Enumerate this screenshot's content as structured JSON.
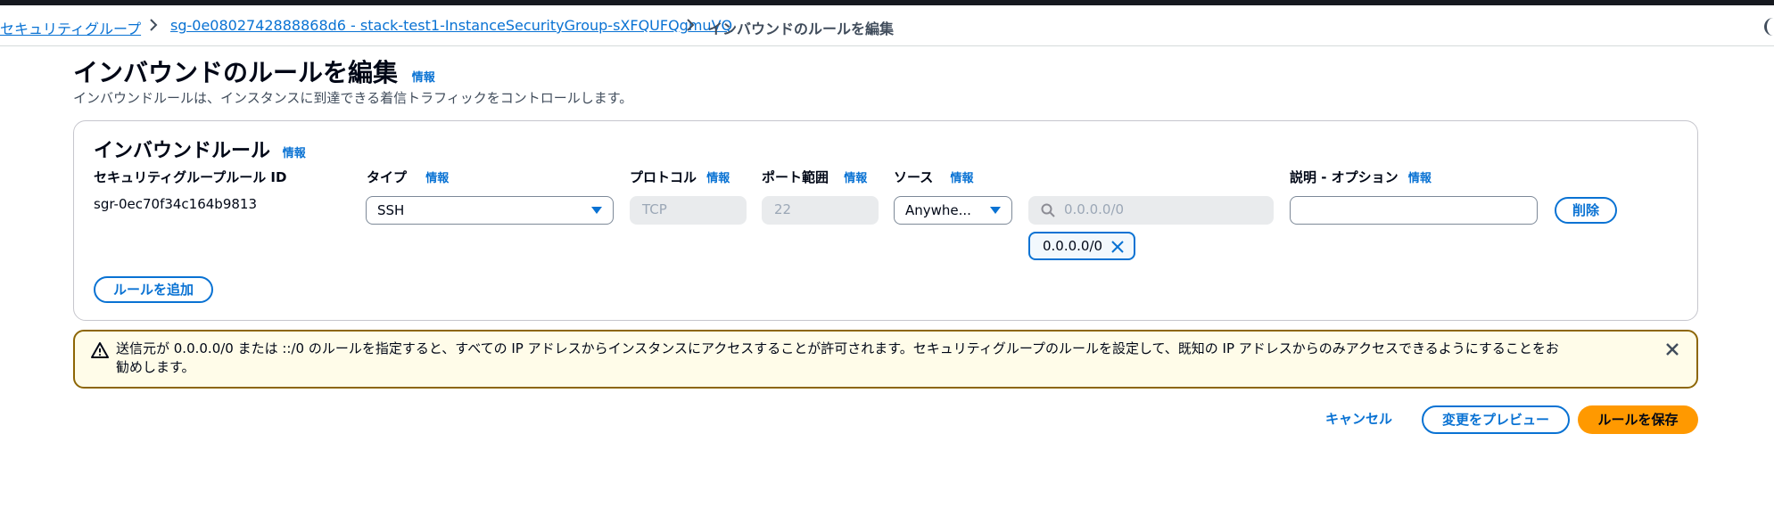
{
  "breadcrumbs": {
    "items": [
      {
        "label": "セキュリティグループ"
      },
      {
        "label": "sg-0e0802742888868d6 - stack-test1-InstanceSecurityGroup-sXFQUFQgmuVQ"
      }
    ],
    "current": "インバウンドのルールを編集"
  },
  "page": {
    "title": "インバウンドのルールを編集",
    "info": "情報",
    "description": "インバウンドルールは、インスタンスに到達できる着信トラフィックをコントロールします。"
  },
  "rules_panel": {
    "title": "インバウンドルール",
    "info": "情報",
    "columns": {
      "rule_id": "セキュリティグループルール ID",
      "type": "タイプ",
      "protocol": "プロトコル",
      "port_range": "ポート範囲",
      "source": "ソース",
      "description": "説明 - オプション",
      "info": "情報"
    },
    "rows": [
      {
        "rule_id": "sgr-0ec70f34c164b9813",
        "type": "SSH",
        "protocol": "TCP",
        "port_range": "22",
        "source": "Anywhe...",
        "source_search_placeholder": "0.0.0.0/0",
        "source_token": "0.0.0.0/0",
        "description": "",
        "delete_label": "削除"
      }
    ],
    "add_rule_label": "ルールを追加"
  },
  "alert": {
    "line1": "送信元が 0.0.0.0/0 または ::/0 のルールを指定すると、すべての IP アドレスからインスタンスにアクセスすることが許可されます。セキュリティグループのルールを設定して、既知の IP アドレスからのみアクセスできるようにすることをお",
    "line2": "勧めします。"
  },
  "actions": {
    "cancel": "キャンセル",
    "preview": "変更をプレビュー",
    "save": "ルールを保存"
  },
  "colors": {
    "link": "#0972d3",
    "primary": "#ff9900",
    "warning_border": "#8d6605",
    "warning_bg": "#fffce9"
  }
}
